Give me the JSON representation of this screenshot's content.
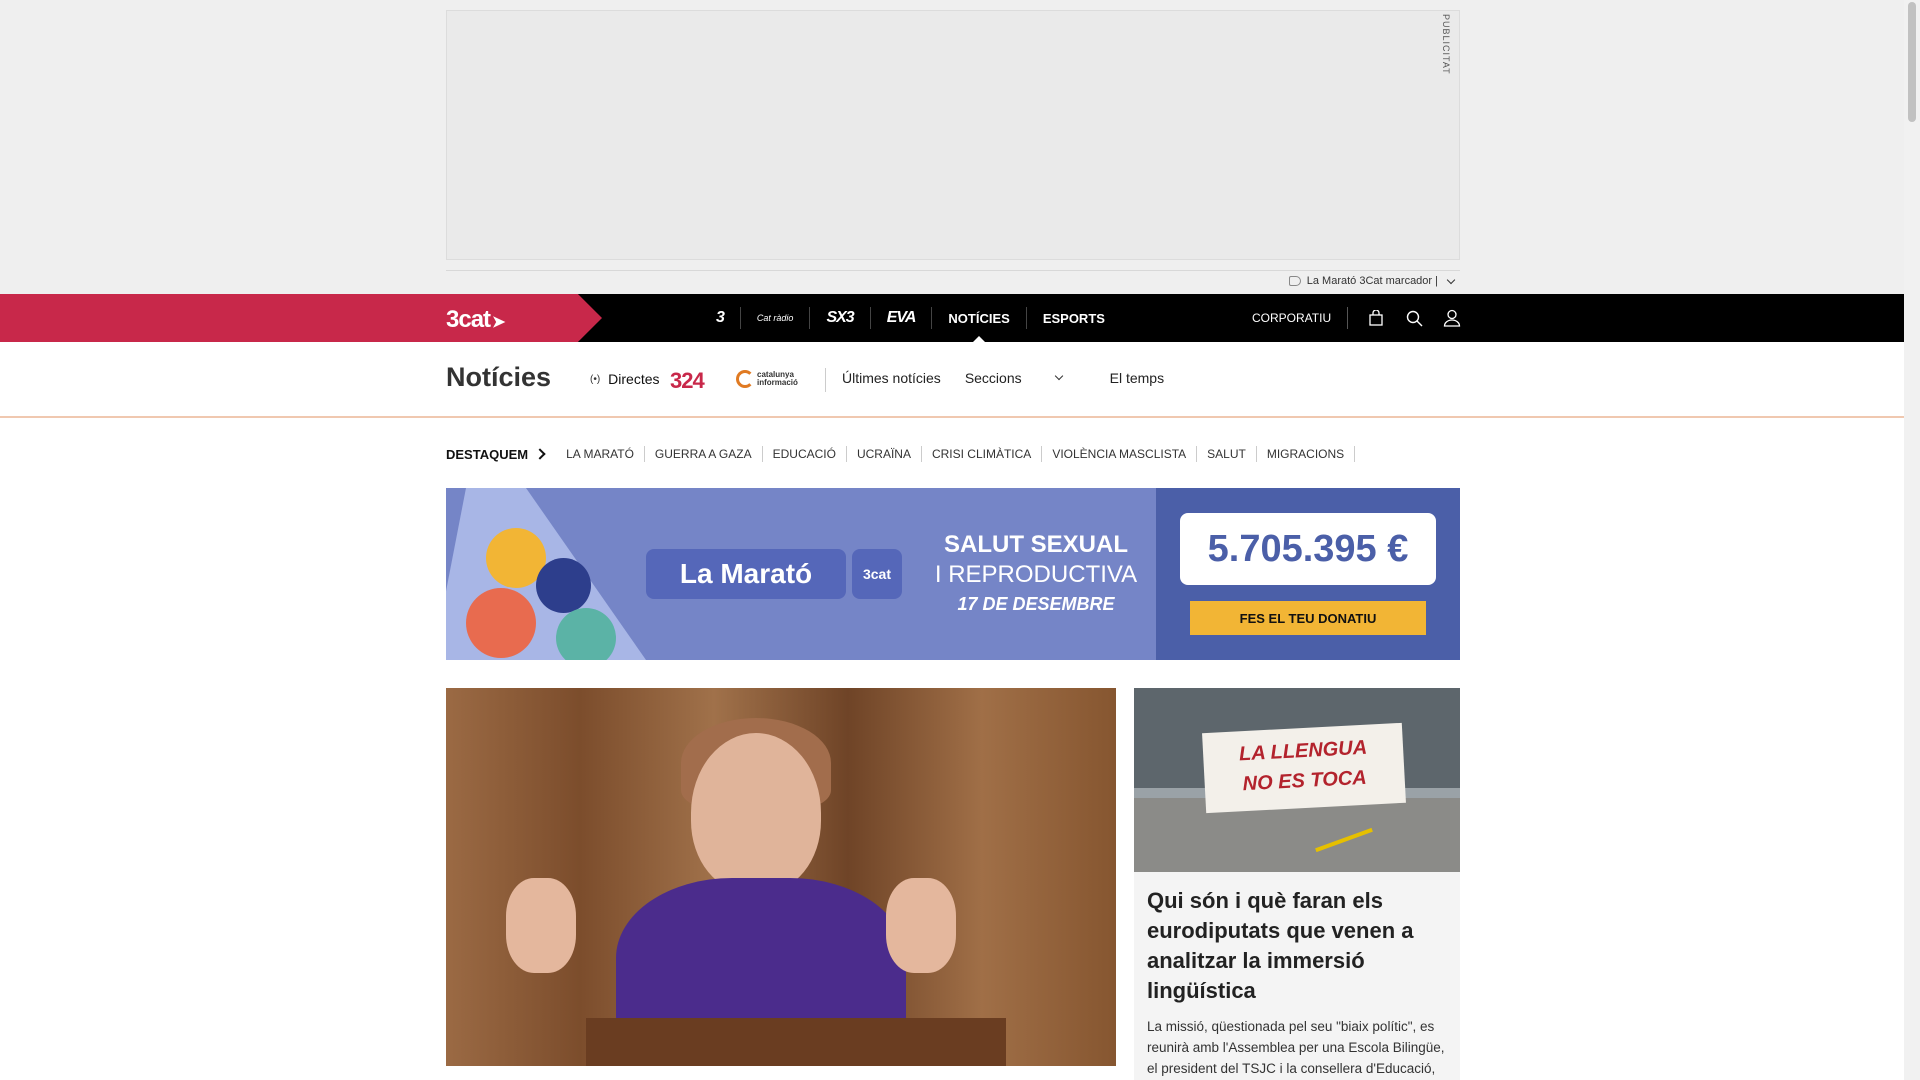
{
  "ad": {
    "label": "PUBLICITAT",
    "marcador": "La Marató 3Cat marcador |"
  },
  "topnav": {
    "brand": "3cat",
    "channels": [
      {
        "label": "3"
      },
      {
        "label": "Cat ràdio"
      },
      {
        "label": "SX3"
      },
      {
        "label": "EVA"
      },
      {
        "label": "NOTÍCIES"
      },
      {
        "label": "ESPORTS"
      }
    ],
    "corporatiu": "CORPORATIU",
    "icons": [
      "shop-bag-icon",
      "search-icon",
      "user-icon"
    ]
  },
  "section": {
    "title": "Notícies",
    "directes": "Directes",
    "logo_324": "324",
    "logo_ci": [
      "catalunya",
      "informació"
    ],
    "links": [
      "Últimes notícies",
      "Seccions",
      "El temps"
    ]
  },
  "destaquem": {
    "title": "DESTAQUEM",
    "items": [
      "LA MARATÓ",
      "GUERRA A GAZA",
      "EDUCACIÓ",
      "UCRAÏNA",
      "CRISI CLIMÀTICA",
      "VIOLÈNCIA MASCLISTA",
      "SALUT",
      "MIGRACIONS"
    ]
  },
  "banner": {
    "marato": "La Marató",
    "marato_brand": "3cat",
    "slogan_line1": "SALUT SEXUAL",
    "slogan_line2": "I REPRODUCTIVA",
    "date": "17 DE DESEMBRE",
    "amount": "5.705.395 €",
    "donate_button": "FES EL TEU DONATIU",
    "colors": {
      "background": "#7585c7",
      "panel": "#4b5fa8",
      "button": "#f2b535"
    }
  },
  "side_article": {
    "photo_text_line1": "LA LLENGUA",
    "photo_text_line2": "NO ES TOCA",
    "title": "Qui són i què faran els eurodiputats que venen a analitzar la immersió lingüística",
    "summary": "La missió, qüestionada pel seu \"biaix polític\", es reunirà amb l'Assemblea per una Escola Bilingüe, el president del TSJC i la consellera d'Educació,"
  },
  "colors": {
    "brand": "#c8284a",
    "nav_bg": "#000000"
  }
}
